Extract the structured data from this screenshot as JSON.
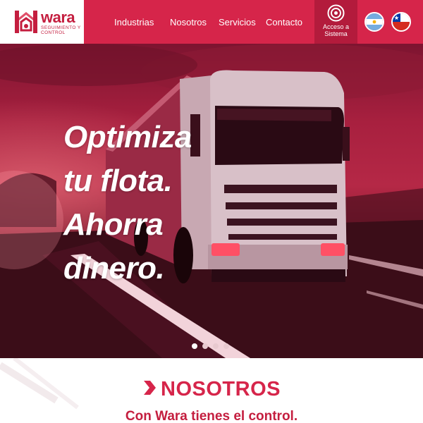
{
  "header": {
    "logo": {
      "name": "wara",
      "tagline": "Seguimiento y control"
    },
    "nav": [
      {
        "label": "Industrias"
      },
      {
        "label": "Nosotros"
      },
      {
        "label": "Servicios"
      },
      {
        "label": "Contacto"
      }
    ],
    "access": {
      "label_line1": "Acceso a",
      "label_line2": "Sistema",
      "icon": "target-icon"
    },
    "flags": [
      {
        "country": "argentina",
        "icon": "argentina-flag-icon"
      },
      {
        "country": "chile",
        "icon": "chile-flag-icon"
      }
    ],
    "colors": {
      "brand": "#d6254a",
      "access_bg": "#b31b3c"
    }
  },
  "hero": {
    "headline": [
      "Optimiza",
      "tu flota.",
      "Ahorra",
      "dinero."
    ],
    "slides": {
      "count": 4,
      "active": 1
    }
  },
  "section": {
    "title": "NOSOTROS",
    "subtitle": "Con Wara tienes el control."
  }
}
